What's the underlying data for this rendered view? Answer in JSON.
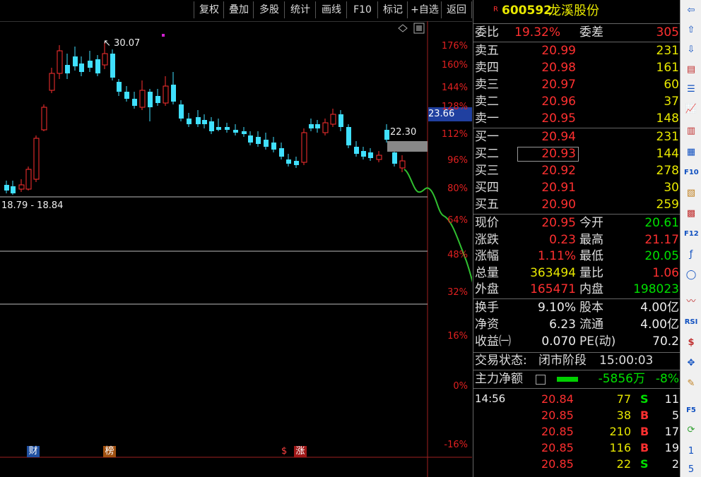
{
  "toolbar": {
    "buttons": [
      "复权",
      "叠加",
      "多股",
      "统计",
      "画线",
      "F10",
      "标记",
      "+自选",
      "返回"
    ]
  },
  "chart": {
    "price_labels": {
      "high": "30.07",
      "right": "22.30",
      "range": "18.79 - 18.84",
      "current_tag": "23.66"
    },
    "pct_ticks": [
      "176%",
      "160%",
      "144%",
      "128%",
      "112%",
      "96%",
      "80%",
      "64%",
      "48%",
      "32%",
      "16%",
      "0%",
      "-16%"
    ],
    "markers": {
      "cai": "财",
      "bang": "榜",
      "dollar": "$",
      "zhang": "涨"
    }
  },
  "panel": {
    "header": {
      "badge": "R",
      "code": "600592",
      "name": "龙溪股份"
    },
    "weibi": {
      "label": "委比",
      "value": "19.32%",
      "label2": "委差",
      "value2": "305"
    },
    "asks": [
      {
        "label": "卖五",
        "price": "20.99",
        "vol": "231"
      },
      {
        "label": "卖四",
        "price": "20.98",
        "vol": "161"
      },
      {
        "label": "卖三",
        "price": "20.97",
        "vol": "60"
      },
      {
        "label": "卖二",
        "price": "20.96",
        "vol": "37"
      },
      {
        "label": "卖一",
        "price": "20.95",
        "vol": "148"
      }
    ],
    "bids": [
      {
        "label": "买一",
        "price": "20.94",
        "vol": "231"
      },
      {
        "label": "买二",
        "price": "20.93",
        "vol": "144"
      },
      {
        "label": "买三",
        "price": "20.92",
        "vol": "278"
      },
      {
        "label": "买四",
        "price": "20.91",
        "vol": "30"
      },
      {
        "label": "买五",
        "price": "20.90",
        "vol": "259"
      }
    ],
    "stats": [
      {
        "l1": "现价",
        "v1": "20.95",
        "c1": "red",
        "l2": "今开",
        "v2": "20.61",
        "c2": "green"
      },
      {
        "l1": "涨跌",
        "v1": "0.23",
        "c1": "red",
        "l2": "最高",
        "v2": "21.17",
        "c2": "red"
      },
      {
        "l1": "涨幅",
        "v1": "1.11%",
        "c1": "red",
        "l2": "最低",
        "v2": "20.05",
        "c2": "green"
      },
      {
        "l1": "总量",
        "v1": "363494",
        "c1": "yellow",
        "l2": "量比",
        "v2": "1.06",
        "c2": "red"
      },
      {
        "l1": "外盘",
        "v1": "165471",
        "c1": "red",
        "l2": "内盘",
        "v2": "198023",
        "c2": "green"
      }
    ],
    "stats2": [
      {
        "l1": "换手",
        "v1": "9.10%",
        "l2": "股本",
        "v2": "4.00亿"
      },
      {
        "l1": "净资",
        "v1": "6.23",
        "l2": "流通",
        "v2": "4.00亿"
      },
      {
        "l1": "收益㈠",
        "v1": "0.070",
        "l2": "PE(动)",
        "v2": "70.2"
      }
    ],
    "status": {
      "label": "交易状态:",
      "value": "闭市阶段",
      "time": "15:00:03"
    },
    "main_force": {
      "label": "主力净额",
      "value": "-5856万",
      "pct": "-8%"
    },
    "ticks": [
      {
        "time": "14:56",
        "price": "20.84",
        "vol": "77",
        "side": "S",
        "n": "11"
      },
      {
        "time": "",
        "price": "20.85",
        "vol": "38",
        "side": "B",
        "n": "5"
      },
      {
        "time": "",
        "price": "20.85",
        "vol": "210",
        "side": "B",
        "n": "17"
      },
      {
        "time": "",
        "price": "20.85",
        "vol": "116",
        "side": "B",
        "n": "19"
      },
      {
        "time": "",
        "price": "20.85",
        "vol": "22",
        "side": "S",
        "n": "2"
      }
    ]
  },
  "sidebar": {
    "labels": [
      "F10",
      "F12",
      "RSI",
      "$",
      "F5",
      "1",
      "5"
    ]
  }
}
